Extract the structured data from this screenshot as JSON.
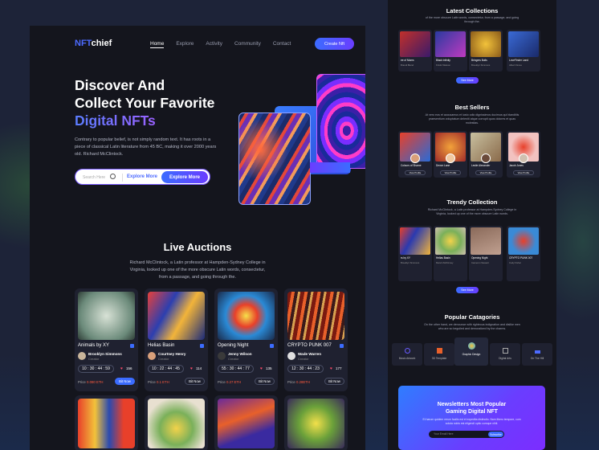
{
  "nav": {
    "logo_a": "NFT",
    "logo_b": "chief",
    "links": [
      "Home",
      "Explore",
      "Activity",
      "Community",
      "Contact"
    ],
    "create_label": "Create Nft"
  },
  "hero": {
    "title_1": "Discover And",
    "title_2": "Collect Your Favorite",
    "title_3": "Digital NFTs",
    "description": "Contrary to popular belief, is not simply random text. It has roots in a piece of classical Latin literature from 45 BC, making it over 2000 years old. Richard McClintock.",
    "search_placeholder": "Search Here",
    "explore_link": "Explore More",
    "explore_button": "Explore More"
  },
  "live_auctions": {
    "title": "Live Auctions",
    "description": "Richard McClintock, a Latin professor at Hampden-Sydney College in Virginia, looked up one of the more obscure Latin words, consectetur, from a passage, and going through the.",
    "cards": [
      {
        "name": "Animals by XY",
        "creator": "Brooklyn Simmons",
        "role": "Creator",
        "timer": "10 : 30 : 44 : 59",
        "likes": "156",
        "price_label": "Price",
        "price": "0.080 ETH",
        "bid": "Bit Now"
      },
      {
        "name": "Helias Basin",
        "creator": "Courtney Henry",
        "role": "Creator",
        "timer": "10 : 22 : 44 : 45",
        "likes": "114",
        "price_label": "Price",
        "price": "0.1 ETH",
        "bid": "Bit Now"
      },
      {
        "name": "Opening Night",
        "creator": "Jenny Wilson",
        "role": "Creator",
        "timer": "55 : 30 : 44 : 77",
        "likes": "135",
        "price_label": "Price",
        "price": "0.27 ETH",
        "bid": "Bit Now"
      },
      {
        "name": "CRYPTO PUNK 007",
        "creator": "Wade Warren",
        "role": "Creator",
        "timer": "12 : 30 : 44 : 23",
        "likes": "177",
        "price_label": "Price",
        "price": "0.28ETH",
        "bid": "Bit Now"
      }
    ]
  },
  "latest": {
    "title": "Latest Collections",
    "description": "of the more obscure Latin words, consectetur, from a passage, and going through the.",
    "cards": [
      {
        "name": "ee of Moms",
        "sub": "Brandi Blend"
      },
      {
        "name": "Black Infinity",
        "sub": "Kristin Watson"
      },
      {
        "name": "Bringers Bulls",
        "sub": "Brooklyn Simmons"
      },
      {
        "name": "LoveFinder Land",
        "sub": "Albert Flores"
      }
    ],
    "button": "See More"
  },
  "sellers": {
    "title": "Best Sellers",
    "description": "At vero eos et accusamus et iusto odio dignissimos ducimus qui blanditiis praesentium voluptatum deleniti atque corrupti quos dolores et quas molestias.",
    "cards": [
      {
        "name": "Colours of Shame",
        "button": "View Profile"
      },
      {
        "name": "Devon Lane",
        "button": "View Profile"
      },
      {
        "name": "Leslie Alexander",
        "button": "View Profile"
      },
      {
        "name": "Jacob Jones",
        "button": "View Profile"
      }
    ]
  },
  "trendy": {
    "title": "Trendy Collection",
    "description": "Richard McClintock, a Latin professor at Hampden-Sydney College in Virginia, looked up one of the more obscure Latin words.",
    "cards": [
      {
        "name": "rs by XY",
        "sub": "Brooklyn Simmons"
      },
      {
        "name": "Helias Basin",
        "sub": "Marvin McKinney"
      },
      {
        "name": "Opening Night",
        "sub": "Cameron Stewart"
      },
      {
        "name": "CRYPTO PUNK 007",
        "sub": "Cody Fisher"
      }
    ],
    "button": "See More"
  },
  "categories": {
    "title": "Popular Catagories",
    "description": "On the other hand, we denounce with righteous indignation and dislike men who are so beguiled and demoralized by the charms.",
    "items": [
      "Music Artwork",
      "3D Template",
      "Graphic Design",
      "Digital Arts",
      "On The Hill"
    ]
  },
  "newsletter": {
    "title_1": "Newsletters Most Popular",
    "title_2": "Gaming Digital NFT",
    "description": "Et harum quidem rerum facilis est et expedita distinctio. Nam libero tempore, cum soluta nobis est eligendi optio cumque nihil.",
    "placeholder": "Your Email Here",
    "button": "Subscribe"
  }
}
